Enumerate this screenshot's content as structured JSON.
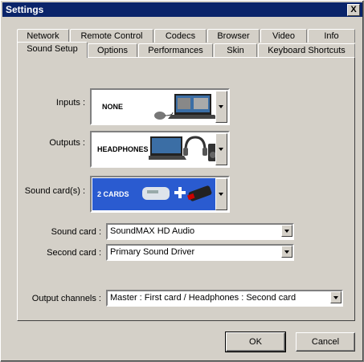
{
  "window": {
    "title": "Settings",
    "close_label": "X"
  },
  "tabs_row1": [
    "Network",
    "Remote Control",
    "Codecs",
    "Browser",
    "Video",
    "Info"
  ],
  "tabs_row2": [
    "Sound Setup",
    "Options",
    "Performances",
    "Skin",
    "Keyboard Shortcuts"
  ],
  "active_tab": "Sound Setup",
  "sound_setup": {
    "inputs": {
      "label": "Inputs :",
      "value": "NONE"
    },
    "outputs": {
      "label": "Outputs :",
      "value": "HEADPHONES"
    },
    "sound_cards": {
      "label": "Sound card(s) :",
      "value": "2 CARDS"
    },
    "sound_card": {
      "label": "Sound card :",
      "value": "SoundMAX HD Audio"
    },
    "second_card": {
      "label": "Second card :",
      "value": "Primary Sound Driver"
    },
    "output_channels": {
      "label": "Output channels :",
      "value": "Master : First card / Headphones : Second card"
    }
  },
  "buttons": {
    "ok": "OK",
    "cancel": "Cancel"
  },
  "colors": {
    "titlebar": "#0a246a",
    "face": "#d4d0c8",
    "cards_bg": "#2a5bd0"
  }
}
